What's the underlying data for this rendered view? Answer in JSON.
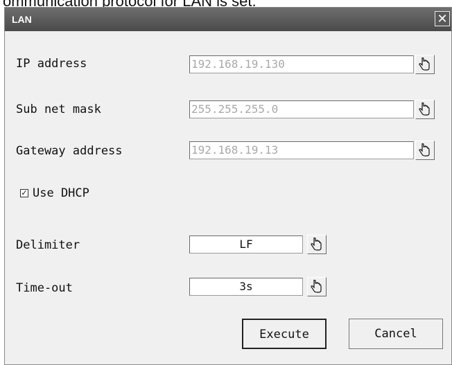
{
  "caption": "ommunication protocol for LAN is set.",
  "dialog": {
    "title": "LAN",
    "close_glyph": "✕"
  },
  "fields": {
    "ip": {
      "label": "IP address",
      "value": "192.168.19.130"
    },
    "subnet": {
      "label": "Sub net mask",
      "value": "255.255.255.0"
    },
    "gateway": {
      "label": "Gateway address",
      "value": "192.168.19.13"
    },
    "delimiter": {
      "label": "Delimiter",
      "value": "LF"
    },
    "timeout": {
      "label": "Time-out",
      "value": "3s"
    }
  },
  "dhcp": {
    "label": "Use DHCP",
    "checked": true,
    "check_glyph": "✓"
  },
  "buttons": {
    "execute": "Execute",
    "cancel": "Cancel"
  },
  "icons": {
    "picker": "hand-pointer-icon",
    "close": "close-icon"
  }
}
